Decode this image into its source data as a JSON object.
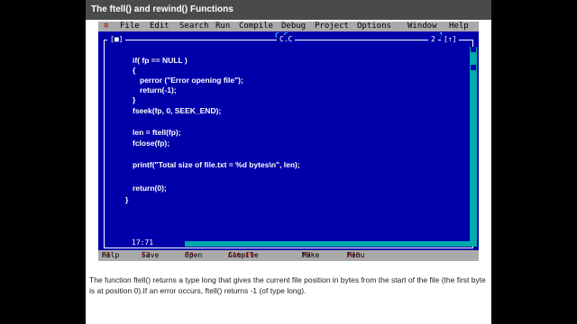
{
  "slide": {
    "title": "The ftell() and rewind() Functions",
    "caption": "The function ftell() returns a type long that gives the current file position in bytes from the start of the file (the first byte is at position 0).If an error occurs, ftell() returns -1 (of type long)."
  },
  "ide": {
    "menu": [
      "File",
      "Edit",
      "Search",
      "Run",
      "Compile",
      "Debug",
      "Project",
      "Options",
      "Window",
      "Help"
    ],
    "system_menu_glyph": "≡",
    "tab_title": "C.C",
    "tab_number": "1",
    "window_title": "C.C",
    "window_number": "2",
    "window_close": "[■]",
    "window_zoom": "[↑]",
    "code_lines": [
      "if( fp == NULL )",
      "{",
      "perror (\"Error opening file\");",
      "return(-1);",
      "}",
      "fseek(fp, 0, SEEK_END);",
      "",
      "len = ftell(fp);",
      "fclose(fp);",
      "",
      "printf(\"Total size of file.txt = %d bytes\\n\", len);",
      "",
      "return(0);",
      "}"
    ],
    "cursor_position": "17:71",
    "function_keys": [
      {
        "key": "F1",
        "label": "Help"
      },
      {
        "key": "F2",
        "label": "Save"
      },
      {
        "key": "F3",
        "label": "Open"
      },
      {
        "key": "Alt-F9",
        "label": "Compile"
      },
      {
        "key": "F9",
        "label": "Make"
      },
      {
        "key": "F10",
        "label": "Menu"
      }
    ],
    "colors": {
      "editor_bg": "#0000aa",
      "menu_bg": "#aaaaaa",
      "hotkey": "#aa0000",
      "scroll": "#00aaaa"
    }
  }
}
